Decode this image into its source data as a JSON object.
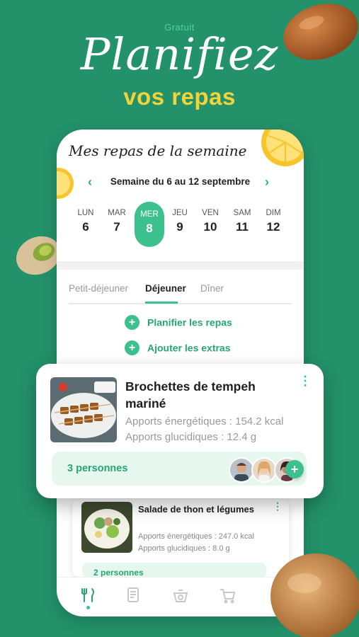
{
  "promo": {
    "badge": "Gratuit",
    "headline": "Planifiez",
    "subheadline": "vos repas"
  },
  "phone": {
    "title": "Mes repas de la semaine",
    "week_label": "Semaine du 6 au 12 septembre",
    "days": [
      {
        "name": "LUN",
        "num": "6"
      },
      {
        "name": "MAR",
        "num": "7"
      },
      {
        "name": "MER",
        "num": "8",
        "selected": true
      },
      {
        "name": "JEU",
        "num": "9"
      },
      {
        "name": "VEN",
        "num": "10"
      },
      {
        "name": "SAM",
        "num": "11"
      },
      {
        "name": "DIM",
        "num": "12"
      }
    ],
    "tabs": [
      "Petit-déjeuner",
      "Déjeuner",
      "Dîner"
    ],
    "active_tab": "Déjeuner",
    "actions": {
      "plan": "Planifier les repas",
      "extras": "Ajouter les extras"
    },
    "second_meal": {
      "title": "Salade de thon et légumes",
      "energy": "Apports énergétiques : 247.0 kcal",
      "carbs": "Apports glucidiques : 8.0 g",
      "persons": "2 personnes"
    },
    "bottom_nav": [
      "meals-icon",
      "recipes-icon",
      "scale-icon",
      "cart-icon"
    ]
  },
  "featured_meal": {
    "title": "Brochettes de tempeh mariné",
    "energy": "Apports énergétiques : 154.2 kcal",
    "carbs": "Apports glucidiques : 12.4 g",
    "persons": "3 personnes",
    "add_label": "+"
  },
  "colors": {
    "background": "#23916a",
    "accent": "#3cc08d",
    "headline_yellow": "#f3d33a"
  }
}
